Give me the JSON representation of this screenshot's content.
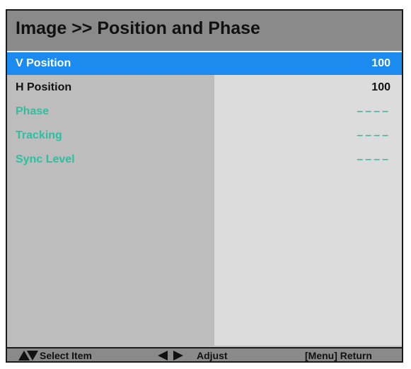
{
  "menu": {
    "title": "Image >> Position and Phase",
    "items": [
      {
        "label": "V Position",
        "value": "100",
        "state": "selected"
      },
      {
        "label": "H Position",
        "value": "100",
        "state": "normal"
      },
      {
        "label": "Phase",
        "value": "––––",
        "state": "disabled"
      },
      {
        "label": "Tracking",
        "value": "––––",
        "state": "disabled"
      },
      {
        "label": "Sync Level",
        "value": "––––",
        "state": "disabled"
      }
    ]
  },
  "footer": {
    "select_label": "Select Item",
    "adjust_label": "Adjust",
    "return_label": "[Menu] Return",
    "select_icons": [
      "up-arrow-icon",
      "down-arrow-icon"
    ],
    "adjust_icons": [
      "left-arrow-icon",
      "right-arrow-icon"
    ]
  },
  "colors": {
    "selected_bg": "#1b8bf0",
    "disabled_text": "#2cc0a0",
    "title_bg": "#8a8a8a",
    "left_column_bg": "#bdbdbd",
    "right_column_bg": "#dcdcdc"
  }
}
